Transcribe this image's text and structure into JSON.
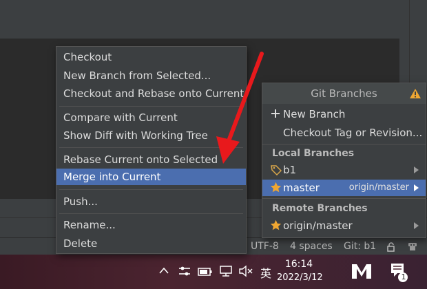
{
  "context_menu": {
    "items": [
      {
        "label": "Checkout"
      },
      {
        "label": "New Branch from Selected..."
      },
      {
        "label": "Checkout and Rebase onto Current"
      },
      {
        "label": "Compare with Current"
      },
      {
        "label": "Show Diff with Working Tree"
      },
      {
        "label": "Rebase Current onto Selected"
      },
      {
        "label": "Merge into Current",
        "selected": true
      },
      {
        "label": "Push..."
      },
      {
        "label": "Rename..."
      },
      {
        "label": "Delete"
      }
    ],
    "selected_color": "#4b6eaf"
  },
  "git_branches": {
    "title": "Git Branches",
    "actions": {
      "new_branch": "New Branch",
      "checkout_tag": "Checkout Tag or Revision..."
    },
    "local_header": "Local Branches",
    "local": [
      {
        "name": "b1",
        "icon": "tag-icon"
      },
      {
        "name": "master",
        "icon": "star-icon",
        "tracking": "origin/master",
        "selected": true
      }
    ],
    "remote_header": "Remote Branches",
    "remote": [
      {
        "name": "origin/master",
        "icon": "star-icon"
      }
    ]
  },
  "status_bar": {
    "encoding": "UTF-8",
    "indent": "4 spaces",
    "git_branch": "Git: b1"
  },
  "taskbar": {
    "ime": "英",
    "time": "16:14",
    "date": "2022/3/12",
    "notification_count": "1"
  },
  "colors": {
    "annotation_arrow": "#e8191c",
    "warning": "#f0a732",
    "star": "#f0a732"
  }
}
